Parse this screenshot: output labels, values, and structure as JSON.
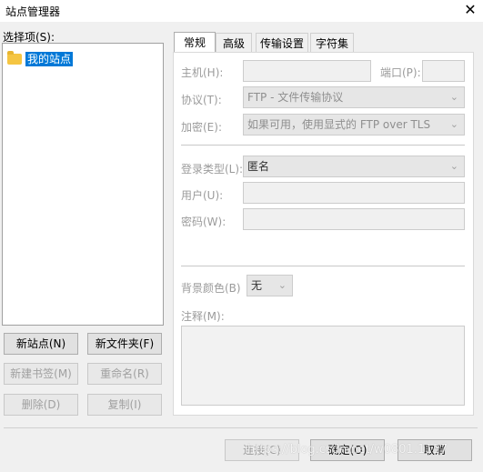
{
  "window": {
    "title": "站点管理器",
    "close_glyph": "✕"
  },
  "left": {
    "select_label": "选择项(S):",
    "tree_items": [
      {
        "label": "我的站点"
      }
    ],
    "buttons": {
      "new_site": "新站点(N)",
      "new_folder": "新文件夹(F)",
      "new_bookmark": "新建书签(M)",
      "rename": "重命名(R)",
      "delete": "删除(D)",
      "copy": "复制(I)"
    }
  },
  "tabs": [
    "常规",
    "高级",
    "传输设置",
    "字符集"
  ],
  "general": {
    "host_label": "主机(H):",
    "host_value": "",
    "port_label": "端口(P):",
    "port_value": "",
    "protocol_label": "协议(T):",
    "protocol_value": "FTP - 文件传输协议",
    "encryption_label": "加密(E):",
    "encryption_value": "如果可用，使用显式的 FTP over TLS",
    "login_type_label": "登录类型(L):",
    "login_type_value": "匿名",
    "user_label": "用户(U):",
    "user_value": "",
    "password_label": "密码(W):",
    "password_value": "",
    "bg_color_label": "背景颜色(B)",
    "bg_color_value": "无",
    "comments_label": "注释(M):",
    "comments_value": ""
  },
  "footer": {
    "connect": "连接(C)",
    "ok": "确定(O)",
    "cancel": "取消"
  },
  "watermark": "https://blog.csdn.net/w0801.1117"
}
